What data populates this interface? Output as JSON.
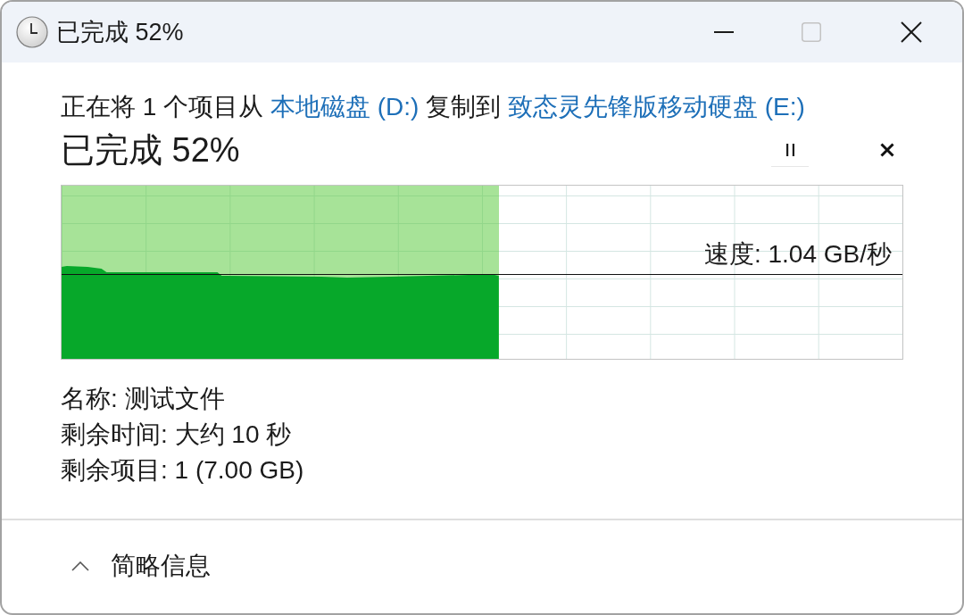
{
  "window": {
    "title": "已完成 52%",
    "maximize_disabled": true
  },
  "description": [
    {
      "kind": "text",
      "text": "正在将 1 个项目从"
    },
    {
      "kind": "link",
      "text": "本地磁盘 (D:)"
    },
    {
      "kind": "text",
      "text": "复制到"
    },
    {
      "kind": "link",
      "text": "致态灵先锋版移动硬盘 (E:)"
    }
  ],
  "status": {
    "title": "已完成 52%"
  },
  "progress": {
    "level": 0.52,
    "speed": "速度: 1.04 GB/秒"
  },
  "details": [
    "名称: 测试文件",
    "剩余时间: 大约 10 秒",
    "剩余项目: 1 (7.00 GB)"
  ],
  "footer": {
    "toggle": "简略信息",
    "expanded": true
  }
}
